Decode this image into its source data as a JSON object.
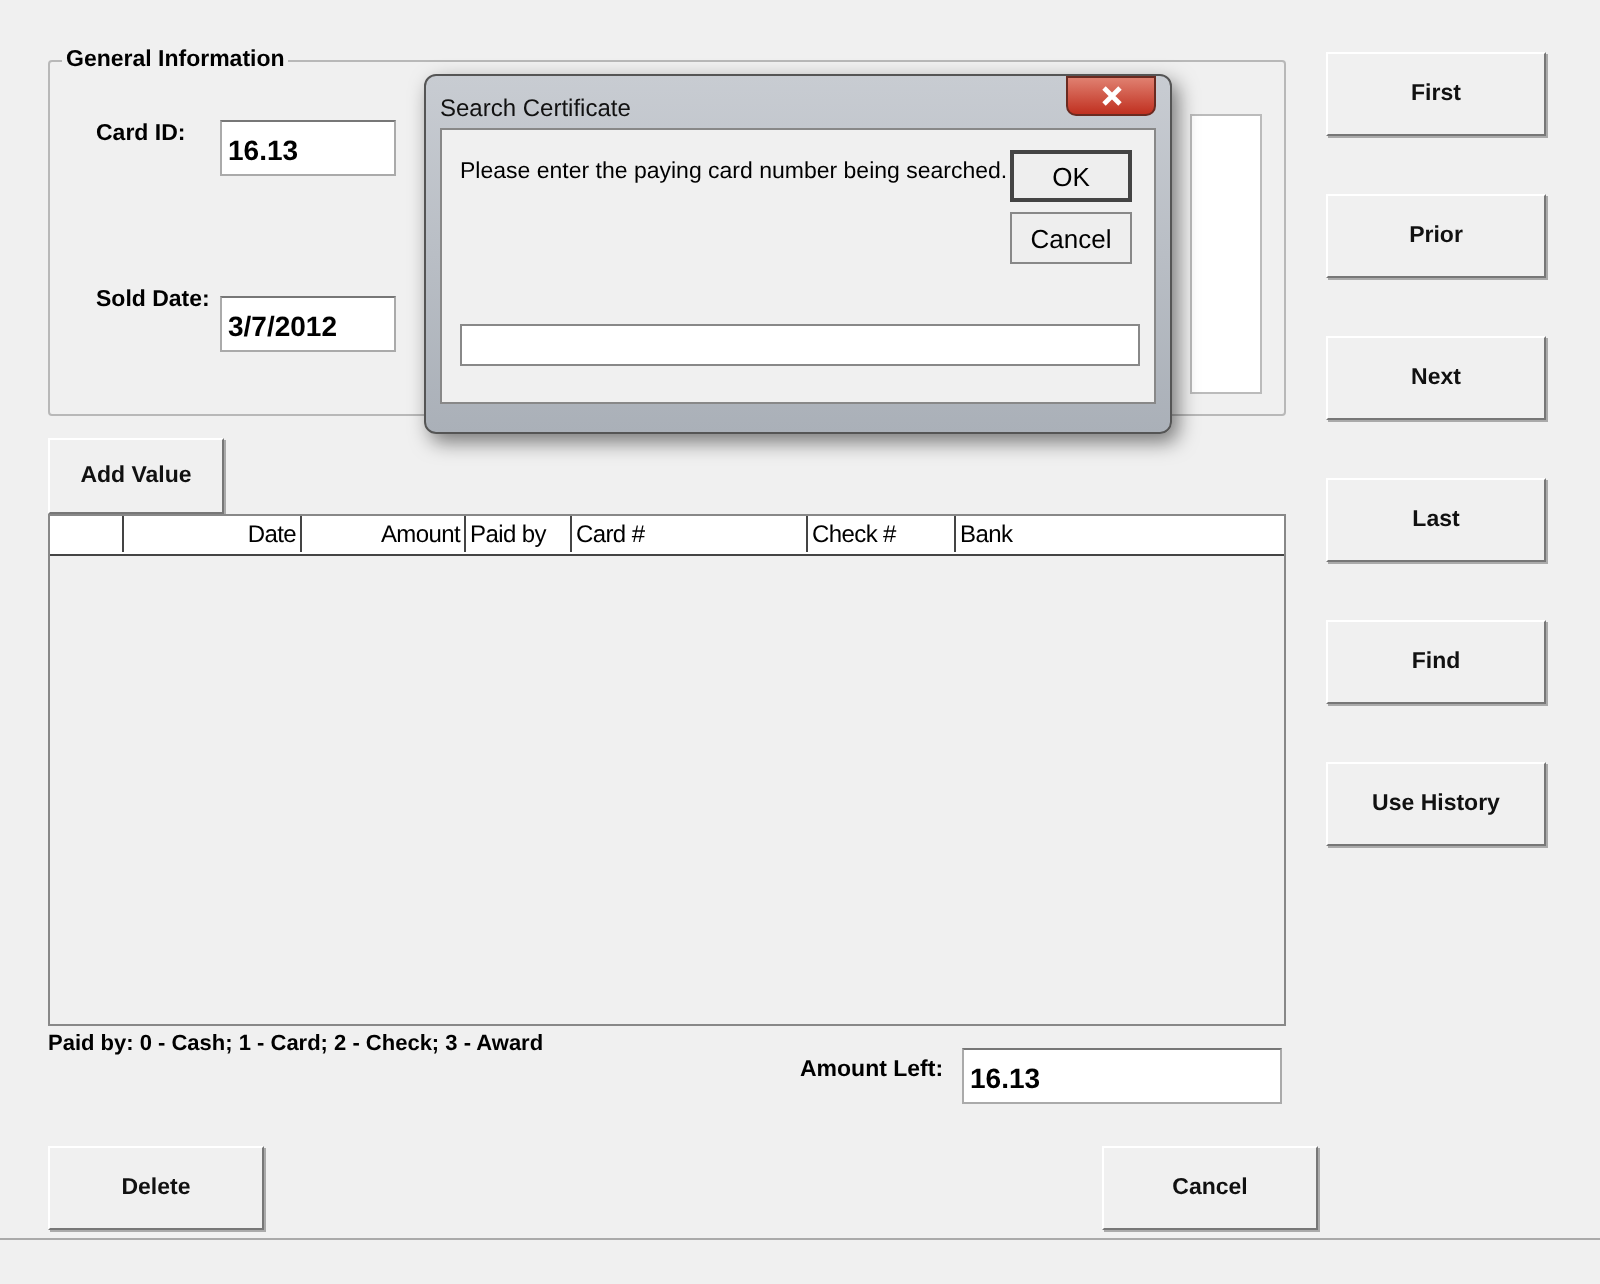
{
  "general_information": {
    "title": "General Information",
    "card_id": {
      "label": "Card ID:",
      "value": "16.13"
    },
    "sold_date": {
      "label": "Sold Date:",
      "value": "3/7/2012"
    }
  },
  "add_value_button": {
    "label": "Add Value"
  },
  "table": {
    "columns": [
      {},
      {
        "label": "Date"
      },
      {
        "label": "Amount"
      },
      {
        "label": "Paid by"
      },
      {
        "label": "Card #"
      },
      {
        "label": "Check #"
      },
      {
        "label": "Bank"
      }
    ]
  },
  "legend": "Paid by: 0 - Cash; 1 - Card; 2 - Check; 3 - Award",
  "amount_left": {
    "label": "Amount Left:",
    "value": "16.13"
  },
  "nav_buttons": [
    {
      "label": "First"
    },
    {
      "label": "Prior"
    },
    {
      "label": "Next"
    },
    {
      "label": "Last"
    },
    {
      "label": "Find"
    },
    {
      "label": "Use History"
    }
  ],
  "bottom_buttons": [
    {
      "label": "Delete"
    },
    {
      "label": "Cancel"
    }
  ],
  "dialog": {
    "title": "Search Certificate",
    "message": "Please enter the paying card number being searched.",
    "buttons": [
      "OK",
      "Cancel"
    ]
  }
}
